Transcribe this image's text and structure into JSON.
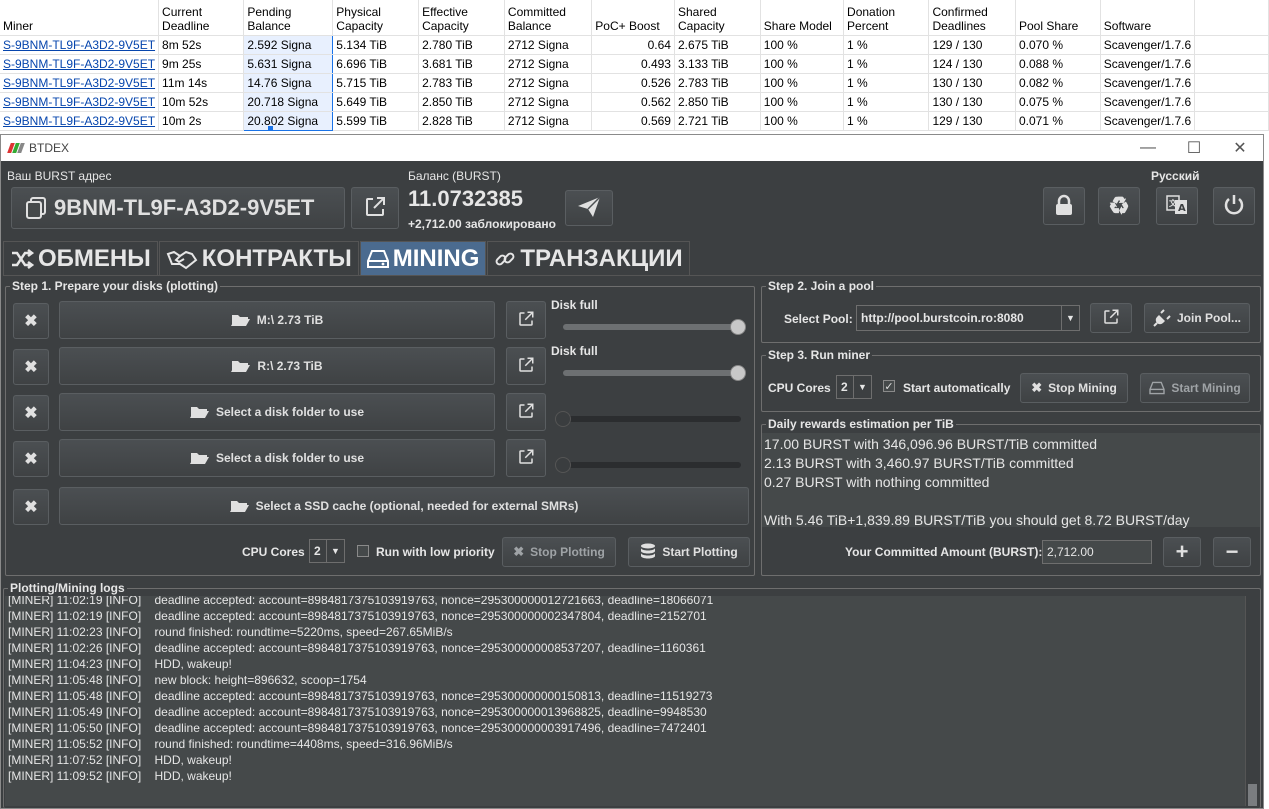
{
  "sheet": {
    "headers": [
      "Miner",
      "Current Deadline",
      "Pending Balance",
      "Physical Capacity",
      "Effective Capacity",
      "Committed Balance",
      "PoC+ Boost",
      "Shared Capacity",
      "Share Model",
      "Donation Percent",
      "Confirmed Deadlines",
      "Pool Share",
      "Software"
    ],
    "rows": [
      [
        "S-9BNM-TL9F-A3D2-9V5ET",
        "8m 52s",
        "2.592 Signa",
        "5.134 TiB",
        "2.780 TiB",
        "2712 Signa",
        "0.64",
        "2.675 TiB",
        "100 %",
        "1 %",
        "129 / 130",
        "0.070 %",
        "Scavenger/1.7.6"
      ],
      [
        "S-9BNM-TL9F-A3D2-9V5ET",
        "9m 25s",
        "5.631 Signa",
        "6.696 TiB",
        "3.681 TiB",
        "2712 Signa",
        "0.493",
        "3.133 TiB",
        "100 %",
        "1 %",
        "124 / 130",
        "0.088 %",
        "Scavenger/1.7.6"
      ],
      [
        "S-9BNM-TL9F-A3D2-9V5ET",
        "11m 14s",
        "14.76 Signa",
        "5.715 TiB",
        "2.783 TiB",
        "2712 Signa",
        "0.526",
        "2.783 TiB",
        "100 %",
        "1 %",
        "130 / 130",
        "0.082 %",
        "Scavenger/1.7.6"
      ],
      [
        "S-9BNM-TL9F-A3D2-9V5ET",
        "10m 52s",
        "20.718 Signa",
        "5.649 TiB",
        "2.850 TiB",
        "2712 Signa",
        "0.562",
        "2.850 TiB",
        "100 %",
        "1 %",
        "130 / 130",
        "0.075 %",
        "Scavenger/1.7.6"
      ],
      [
        "S-9BNM-TL9F-A3D2-9V5ET",
        "10m 2s",
        "20.802 Signa",
        "5.599 TiB",
        "2.828 TiB",
        "2712 Signa",
        "0.569",
        "2.721 TiB",
        "100 %",
        "1 %",
        "129 / 130",
        "0.071 %",
        "Scavenger/1.7.6"
      ]
    ]
  },
  "window": {
    "title": "BTDEX",
    "minimize": "—",
    "maximize": "☐",
    "close": "✕"
  },
  "header": {
    "address_label": "Ваш BURST адрес",
    "address": "9BNM-TL9F-A3D2-9V5ET",
    "balance_label": "Баланс (BURST)",
    "balance": "11.0732385",
    "locked": "+2,712.00 заблокировано",
    "language": "Русский"
  },
  "tabs": [
    {
      "label": "ОБМЕНЫ",
      "icon": "shuffle-icon"
    },
    {
      "label": "КОНТРАКТЫ",
      "icon": "handshake-icon"
    },
    {
      "label": "MINING",
      "icon": "hdd-icon"
    },
    {
      "label": "ТРАНЗАКЦИИ",
      "icon": "link-icon"
    }
  ],
  "step1": {
    "title": "Step 1. Prepare your disks (plotting)",
    "disks": [
      {
        "label": "M:\\ 2.73 TiB",
        "status": "Disk full",
        "fill": 1.0
      },
      {
        "label": "R:\\ 2.73 TiB",
        "status": "Disk full",
        "fill": 1.0
      },
      {
        "label": "Select a disk folder to use",
        "status": "",
        "fill": 0.0
      },
      {
        "label": "Select a disk folder to use",
        "status": "",
        "fill": 0.0
      }
    ],
    "ssd": "Select a SSD cache (optional, needed for external SMRs)",
    "cpu_label": "CPU Cores",
    "cpu_value": "2",
    "low_priority": "Run with low priority",
    "stop_plotting": "Stop Plotting",
    "start_plotting": "Start Plotting"
  },
  "step2": {
    "title": "Step 2. Join a pool",
    "select_label": "Select Pool:",
    "pool_value": "http://pool.burstcoin.ro:8080",
    "join": "Join Pool..."
  },
  "step3": {
    "title": "Step 3. Run miner",
    "cpu_label": "CPU Cores",
    "cpu_value": "2",
    "auto": "Start automatically",
    "auto_checked": true,
    "stop": "Stop Mining",
    "start": "Start Mining"
  },
  "rewards": {
    "title": "Daily rewards estimation per TiB",
    "lines": [
      "17.00 BURST with 346,096.96 BURST/TiB committed",
      "2.13 BURST with 3,460.97 BURST/TiB committed",
      "0.27 BURST with nothing committed",
      "",
      "With 5.46 TiB+1,839.89 BURST/TiB you should get 8.72 BURST/day"
    ],
    "commit_label": "Your Committed Amount (BURST):",
    "commit_value": "2,712.00",
    "plus": "+",
    "minus": "−"
  },
  "logs": {
    "title": "Plotting/Mining logs",
    "lines": [
      "[MINER] 11:02:19 [INFO]    deadline accepted: account=8984817375103919763, nonce=295300000012721663, deadline=18066071",
      "[MINER] 11:02:19 [INFO]    deadline accepted: account=8984817375103919763, nonce=295300000002347804, deadline=2152701",
      "[MINER] 11:02:23 [INFO]    round finished: roundtime=5220ms, speed=267.65MiB/s",
      "[MINER] 11:02:26 [INFO]    deadline accepted: account=8984817375103919763, nonce=295300000008537207, deadline=1160361",
      "[MINER] 11:04:23 [INFO]    HDD, wakeup!",
      "[MINER] 11:05:48 [INFO]    new block: height=896632, scoop=1754",
      "[MINER] 11:05:48 [INFO]    deadline accepted: account=8984817375103919763, nonce=295300000000150813, deadline=11519273",
      "[MINER] 11:05:49 [INFO]    deadline accepted: account=8984817375103919763, nonce=295300000013968825, deadline=9948530",
      "[MINER] 11:05:50 [INFO]    deadline accepted: account=8984817375103919763, nonce=295300000003917496, deadline=7472401",
      "[MINER] 11:05:52 [INFO]    round finished: roundtime=4408ms, speed=316.96MiB/s",
      "[MINER] 11:07:52 [INFO]    HDD, wakeup!",
      "[MINER] 11:09:52 [INFO]    HDD, wakeup!"
    ]
  }
}
